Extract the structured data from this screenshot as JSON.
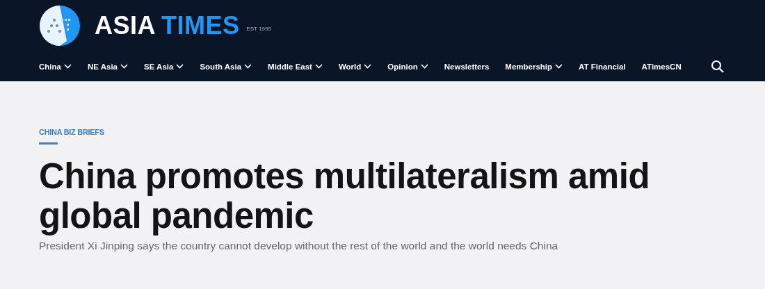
{
  "header": {
    "logo": {
      "word_1": "ASIA",
      "word_2": "TIMES",
      "tagline": "EST 1995"
    },
    "nav": [
      {
        "label": "China",
        "dropdown": true
      },
      {
        "label": "NE Asia",
        "dropdown": true
      },
      {
        "label": "SE Asia",
        "dropdown": true
      },
      {
        "label": "South Asia",
        "dropdown": true
      },
      {
        "label": "Middle East",
        "dropdown": true
      },
      {
        "label": "World",
        "dropdown": true
      },
      {
        "label": "Opinion",
        "dropdown": true
      },
      {
        "label": "Newsletters",
        "dropdown": false
      },
      {
        "label": "Membership",
        "dropdown": true
      },
      {
        "label": "AT Financial",
        "dropdown": false
      },
      {
        "label": "ATimesCN",
        "dropdown": false
      }
    ]
  },
  "article": {
    "category": "CHINA BIZ BRIEFS",
    "headline": "China promotes multilateralism amid global pandemic",
    "subtitle": "President Xi Jinping says the country cannot develop without the rest of the world and the world needs China"
  }
}
